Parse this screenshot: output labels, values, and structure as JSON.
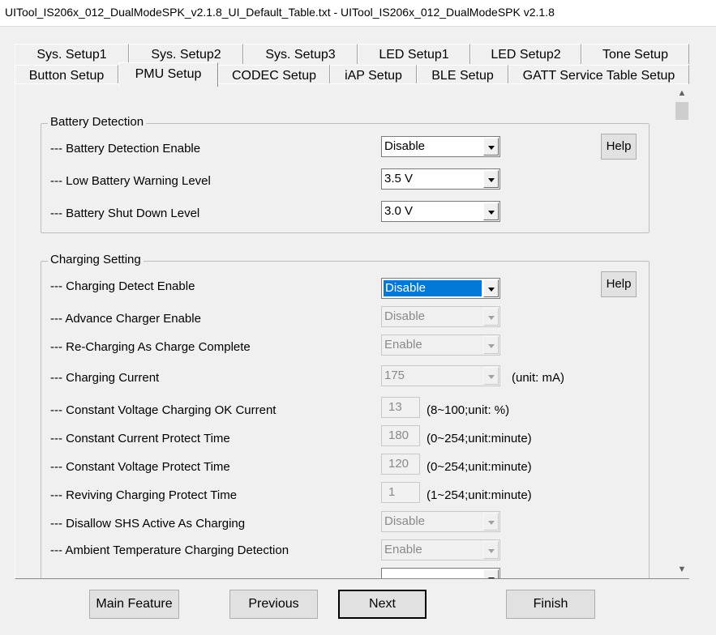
{
  "window": {
    "title": "UITool_IS206x_012_DualModeSPK_v2.1.8_UI_Default_Table.txt - UITool_IS206x_012_DualModeSPK v2.1.8"
  },
  "tabs_row1": [
    "Sys. Setup1",
    "Sys. Setup2",
    "Sys. Setup3",
    "LED Setup1",
    "LED Setup2",
    "Tone Setup"
  ],
  "tabs_row2": [
    "Button Setup",
    "PMU Setup",
    "CODEC Setup",
    "iAP Setup",
    "BLE Setup",
    "GATT Service Table Setup"
  ],
  "active_tab": "PMU Setup",
  "battery": {
    "title": "Battery Detection",
    "help": "Help",
    "rows": [
      {
        "label": "--- Battery Detection Enable",
        "value": "Disable"
      },
      {
        "label": "--- Low Battery Warning Level",
        "value": "3.5 V"
      },
      {
        "label": "--- Battery Shut Down Level",
        "value": "3.0 V"
      }
    ]
  },
  "charging": {
    "title": "Charging Setting",
    "help": "Help",
    "rows": [
      {
        "label": "--- Charging Detect Enable",
        "value": "Disable"
      },
      {
        "label": "--- Advance Charger Enable",
        "value": "Disable"
      },
      {
        "label": "--- Re-Charging As Charge Complete",
        "value": "Enable"
      },
      {
        "label": "--- Charging Current",
        "value": "175",
        "unit": "(unit: mA)"
      },
      {
        "label": "--- Constant Voltage Charging OK Current",
        "value": "13",
        "unit": "(8~100;unit: %)"
      },
      {
        "label": "--- Constant Current Protect Time",
        "value": "180",
        "unit": "(0~254;unit:minute)"
      },
      {
        "label": "--- Constant Voltage Protect Time",
        "value": "120",
        "unit": "(0~254;unit:minute)"
      },
      {
        "label": "--- Reviving Charging Protect Time",
        "value": "1",
        "unit": "(1~254;unit:minute)"
      },
      {
        "label": "--- Disallow SHS Active As Charging",
        "value": "Disable"
      },
      {
        "label": "--- Ambient Temperature Charging Detection",
        "value": "Enable"
      }
    ]
  },
  "buttons": {
    "main_feature": "Main Feature",
    "previous": "Previous",
    "next": "Next",
    "finish": "Finish"
  }
}
